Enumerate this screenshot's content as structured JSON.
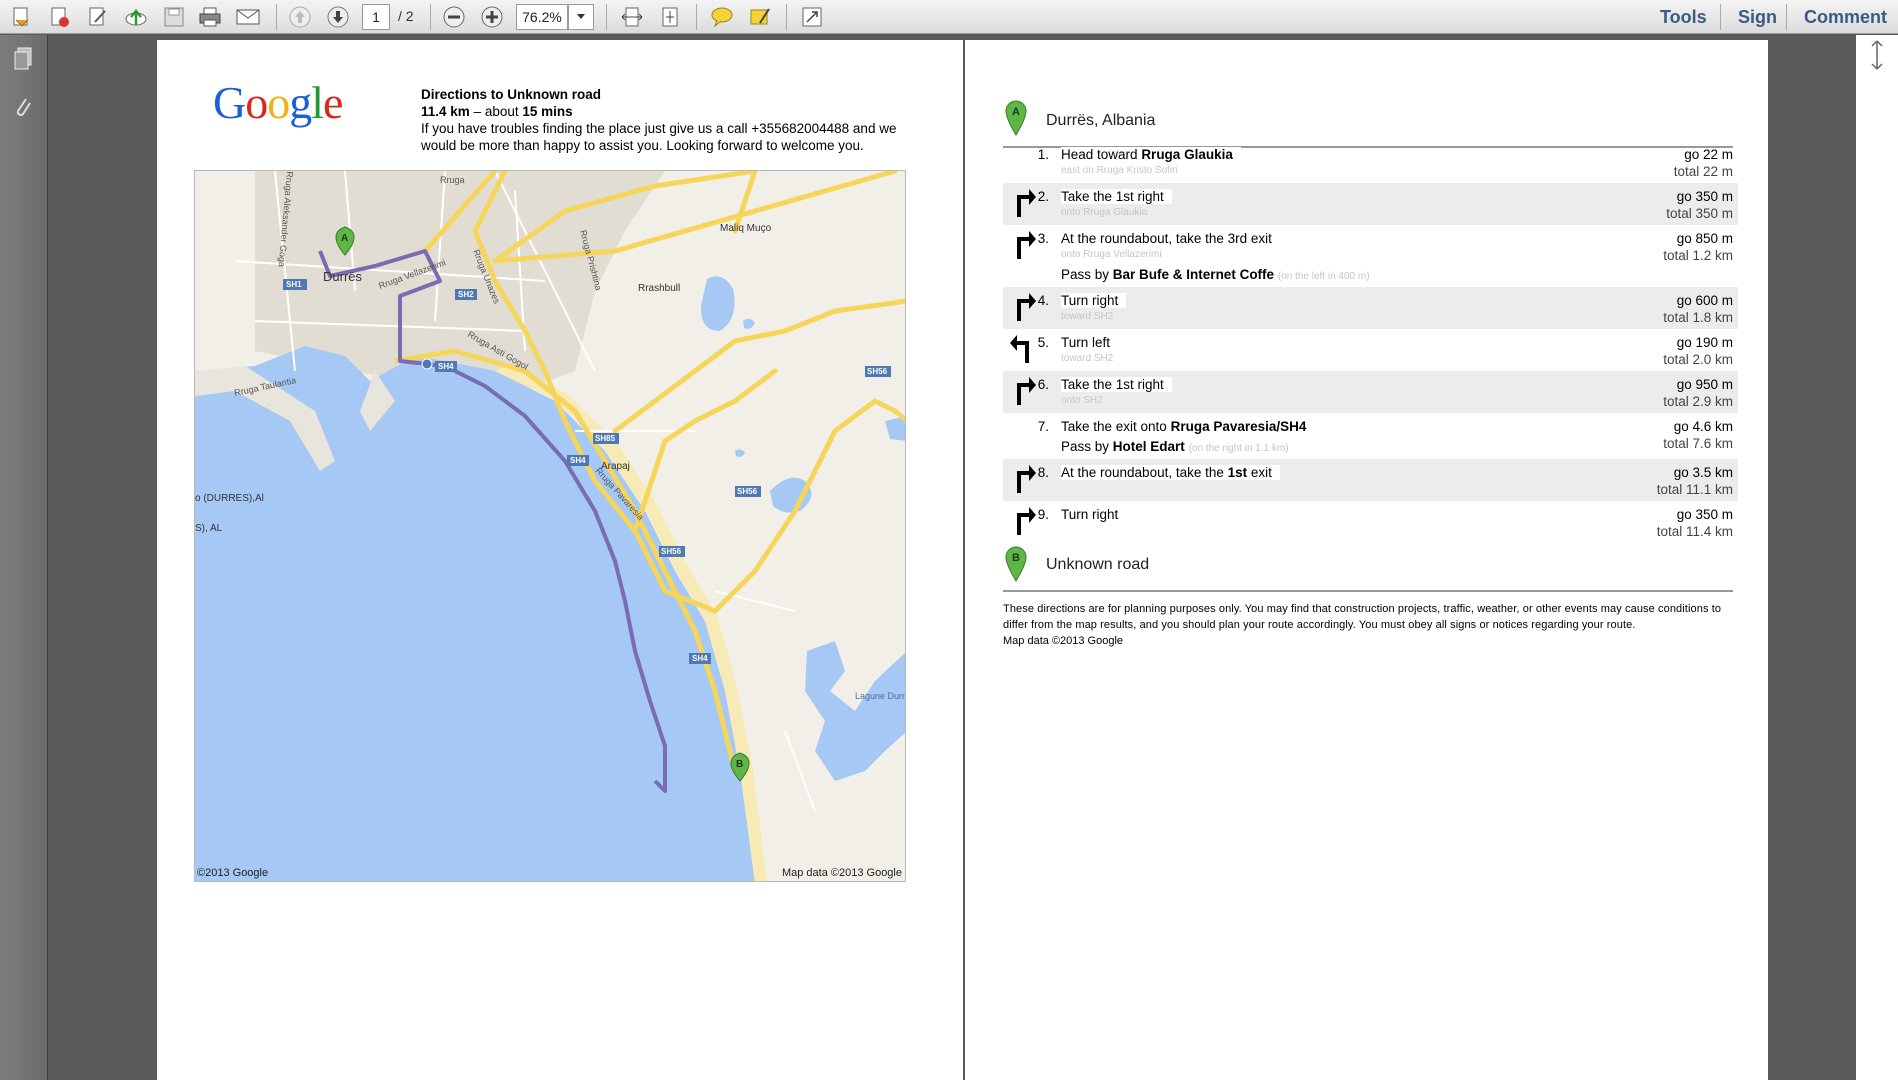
{
  "toolbar": {
    "page_current": "1",
    "page_total": "/ 2",
    "zoom": "76.2%",
    "tools_label": "Tools",
    "sign_label": "Sign",
    "comment_label": "Comment"
  },
  "page1": {
    "logo": "Google",
    "title": "Directions to Unknown road",
    "distance": "11.4 km",
    "about": "– about",
    "duration": "15 mins",
    "description": "If you have troubles finding the place just give us a call +355682004488 and we would be more than happy to assist you. Looking forward to welcome you.",
    "map": {
      "copyright_left": "©2013 Google",
      "copyright_right": "Map data ©2013 Google",
      "labels": {
        "durres": "Durrës",
        "rashbull": "Rrashbull",
        "maliq": "Maliq Muço",
        "arapaj": "Arapaj",
        "rruga_velazerimi": "Rruga Vellazerimi",
        "rruga_unaze": "Rruga Unazes",
        "rruga_prishtina": "Rruga Prishtina",
        "rruga_aleksander": "Rruga Aleksander Goga",
        "rruga_taulantia": "Rruga Taulantia",
        "rruga_asti": "Rruga Asti Gogol",
        "rruga_pavaresia": "Rruga Pavaresia",
        "rruga_short": "Rruga",
        "o_durres": "o (DURRES),Al",
        "s_al": "S), AL",
        "lagune": "Lagune Durrësi",
        "sh1": "SH1",
        "sh2": "SH2",
        "sh4": "SH4",
        "sh85": "SH85",
        "sh56": "SH56",
        "marker_a": "A",
        "marker_b": "B"
      }
    }
  },
  "page2": {
    "origin": "Durrës, Albania",
    "destination": "Unknown road",
    "marker_a": "A",
    "marker_b": "B",
    "steps": [
      {
        "num": "1.",
        "pre": "Head toward",
        "bold": "Rruga Glaukia",
        "post": "",
        "sub": "east on Rruga Kristo Sotiri",
        "go": "go 22 m",
        "total": "total 22 m"
      },
      {
        "num": "2.",
        "pre": "Take the 1st right",
        "bold": "",
        "post": "",
        "sub": "onto Rruga Glaukia",
        "go": "go 350 m",
        "total": "total 350 m"
      },
      {
        "num": "3.",
        "pre": "At the roundabout, take the 3rd exit",
        "bold": "",
        "post": "",
        "sub": "onto Rruga Vellazerimi",
        "go": "go 850 m",
        "total": "total 1.2 km",
        "pass_pre": "Pass by",
        "pass_bold": "Bar Bufe & Internet Coffe",
        "pass_note": "(on the left in 400 m)"
      },
      {
        "num": "4.",
        "pre": "Turn right",
        "bold": "",
        "post": "",
        "sub": "toward SH2",
        "go": "go 600 m",
        "total": "total 1.8 km"
      },
      {
        "num": "5.",
        "pre": "Turn left",
        "bold": "",
        "post": "",
        "sub": "toward SH2",
        "go": "go 190 m",
        "total": "total 2.0 km"
      },
      {
        "num": "6.",
        "pre": "Take the 1st right",
        "bold": "",
        "post": "",
        "sub": "onto SH2",
        "go": "go 950 m",
        "total": "total 2.9 km"
      },
      {
        "num": "7.",
        "pre": "Take the exit onto",
        "bold": "Rruga Pavaresia/SH4",
        "post": "",
        "sub": "",
        "go": "go 4.6 km",
        "total": "total 7.6 km",
        "pass_pre": "Pass by",
        "pass_bold": "Hotel Edart",
        "pass_note": "(on the right in 1.1 km)"
      },
      {
        "num": "8.",
        "pre": "At the roundabout, take the",
        "bold": "1st",
        "post": "exit",
        "sub": "",
        "go": "go 3.5 km",
        "total": "total 11.1 km"
      },
      {
        "num": "9.",
        "pre": "Turn right",
        "bold": "",
        "post": "",
        "sub": "",
        "go": "go 350 m",
        "total": "total 11.4 km"
      }
    ],
    "disclaimer": "These directions are for planning purposes only. You may find that construction projects, traffic, weather, or other events may cause conditions to differ from the map results, and you should plan your route accordingly. You must obey all signs or notices regarding your route.",
    "map_data_note": "Map data ©2013 Google"
  },
  "colors": {
    "marker_green": "#5fb548",
    "route_purple": "#7a6bb3",
    "water_blue": "#a5c8f5",
    "highway_yellow": "#f6d55b",
    "link_blue": "#3b5a86"
  }
}
